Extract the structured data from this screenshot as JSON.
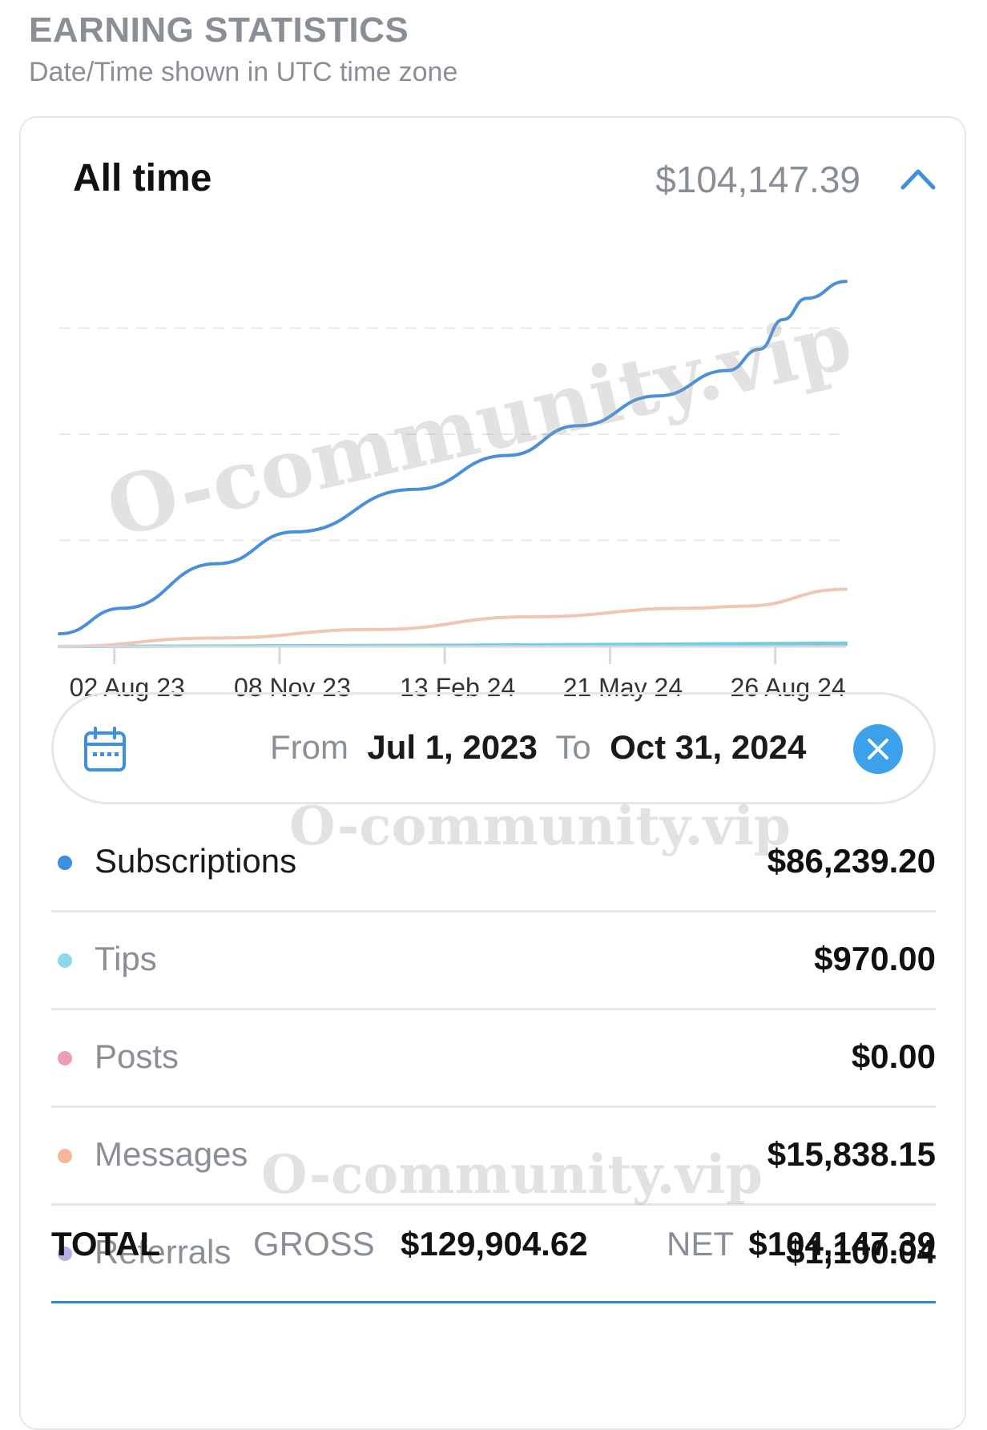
{
  "header": {
    "title": "EARNING STATISTICS",
    "subtitle": "Date/Time shown in UTC time zone"
  },
  "card": {
    "period_label": "All time",
    "period_total": "$104,147.39",
    "collapse_icon": "chevron-up-icon"
  },
  "chart_data": {
    "type": "line",
    "title": "",
    "xlabel": "",
    "ylabel": "",
    "x_tick_labels": [
      "02 Aug 23",
      "08 Nov 23",
      "13 Feb 24",
      "21 May 24",
      "26 Aug 24"
    ],
    "x_range": [
      "2023-07-01",
      "2024-10-31"
    ],
    "y_range": [
      0,
      1
    ],
    "y_axis_labels_visible": false,
    "grid": true,
    "legend": "none",
    "series": [
      {
        "color": "#4a90d9",
        "points": [
          [
            0,
            0.03
          ],
          [
            0.08,
            0.09
          ],
          [
            0.2,
            0.195
          ],
          [
            0.3,
            0.27
          ],
          [
            0.45,
            0.37
          ],
          [
            0.57,
            0.45
          ],
          [
            0.66,
            0.52
          ],
          [
            0.76,
            0.59
          ],
          [
            0.85,
            0.65
          ],
          [
            0.89,
            0.7
          ],
          [
            0.92,
            0.77
          ],
          [
            0.95,
            0.82
          ],
          [
            1,
            0.86
          ]
        ]
      },
      {
        "color": "#f2c4b4",
        "points": [
          [
            0,
            0.0
          ],
          [
            0.2,
            0.02
          ],
          [
            0.4,
            0.04
          ],
          [
            0.6,
            0.07
          ],
          [
            0.8,
            0.09
          ],
          [
            0.87,
            0.095
          ],
          [
            1,
            0.135
          ]
        ]
      },
      {
        "color": "#6fcfe0",
        "points": [
          [
            0,
            0.0
          ],
          [
            0.5,
            0.003
          ],
          [
            1,
            0.008
          ]
        ]
      },
      {
        "color": "#b8a9e0",
        "points": [
          [
            0,
            0.0
          ],
          [
            1,
            0.005
          ]
        ]
      }
    ]
  },
  "watermark": "O-community.vip",
  "date_filter": {
    "from_label": "From",
    "from_value": "Jul 1, 2023",
    "to_label": "To",
    "to_value": "Oct 31, 2024",
    "calendar_icon": "calendar-icon",
    "clear_icon": "close-icon"
  },
  "categories": [
    {
      "name": "Subscriptions",
      "amount": "$86,239.20",
      "color": "#3d8fe0"
    },
    {
      "name": "Tips",
      "amount": "$970.00",
      "color": "#8fd8ea"
    },
    {
      "name": "Posts",
      "amount": "$0.00",
      "color": "#ef9fb4"
    },
    {
      "name": "Messages",
      "amount": "$15,838.15",
      "color": "#f7b79d"
    },
    {
      "name": "Referrals",
      "amount": "$1,100.04",
      "color": "#b9aee3"
    }
  ],
  "totals": {
    "total_label": "TOTAL",
    "gross_label": "GROSS",
    "gross_value": "$129,904.62",
    "net_label": "NET",
    "net_value": "$104,147.39"
  }
}
